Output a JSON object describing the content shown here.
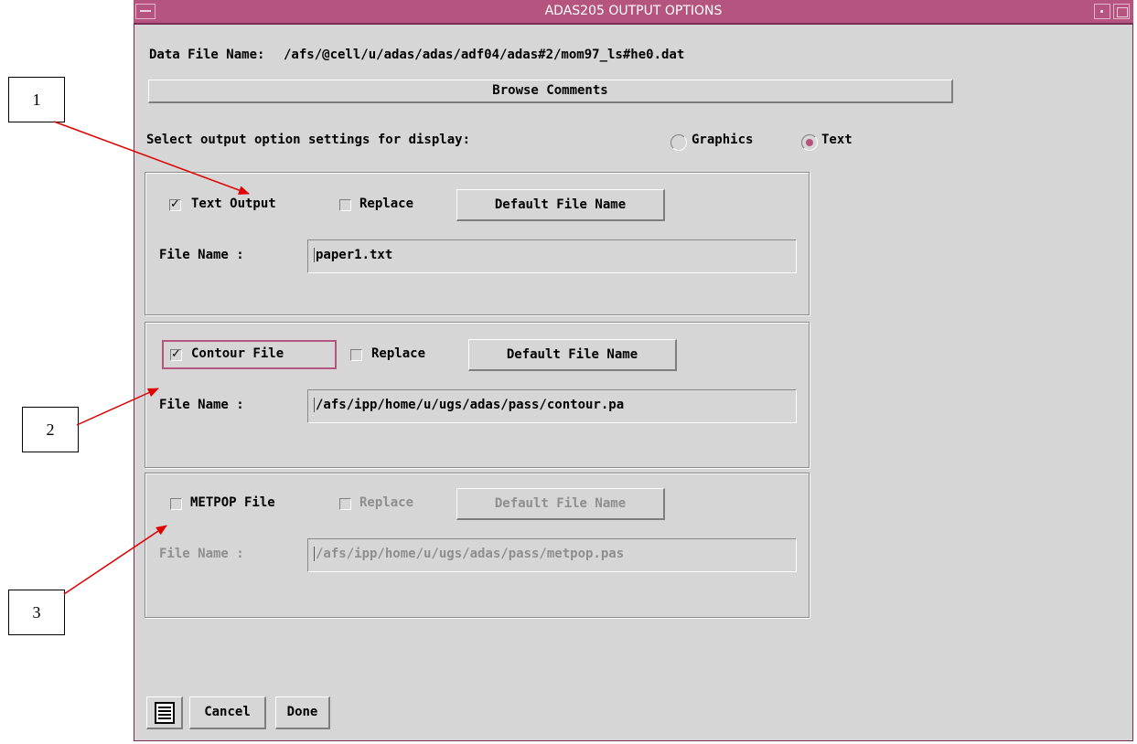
{
  "window": {
    "title": "ADAS205 OUTPUT OPTIONS",
    "title_color": "#b5547e"
  },
  "data_file": {
    "label": "Data File Name:",
    "path": "/afs/@cell/u/adas/adas/adf04/adas#2/mom97_ls#he0.dat"
  },
  "browse_button": "Browse Comments",
  "display_select": {
    "label": "Select output option settings for display:",
    "options": [
      "Graphics",
      "Text"
    ],
    "selected": "Text"
  },
  "sections": {
    "text_output": {
      "checkbox_label": "Text Output",
      "checked": true,
      "replace_label": "Replace",
      "default_button": "Default File Name",
      "file_label": "File Name :",
      "file_value": "paper1.txt",
      "enabled": true
    },
    "contour_file": {
      "checkbox_label": "Contour File",
      "checked": true,
      "replace_label": "Replace",
      "default_button": "Default File Name",
      "file_label": "File Name :",
      "file_value": "/afs/ipp/home/u/ugs/adas/pass/contour.pa",
      "enabled": true
    },
    "metpop_file": {
      "checkbox_label": "METPOP File",
      "checked": false,
      "replace_label": "Replace",
      "default_button": "Default File Name",
      "file_label": "File Name :",
      "file_value": "/afs/ipp/home/u/ugs/adas/pass/metpop.pas",
      "enabled": false
    }
  },
  "footer": {
    "menu_icon": "list-icon",
    "cancel_label": "Cancel",
    "done_label": "Done"
  },
  "callouts": [
    "1",
    "2",
    "3"
  ],
  "colors": {
    "accent": "#b5547e",
    "annotation_arrow": "#e00000"
  }
}
